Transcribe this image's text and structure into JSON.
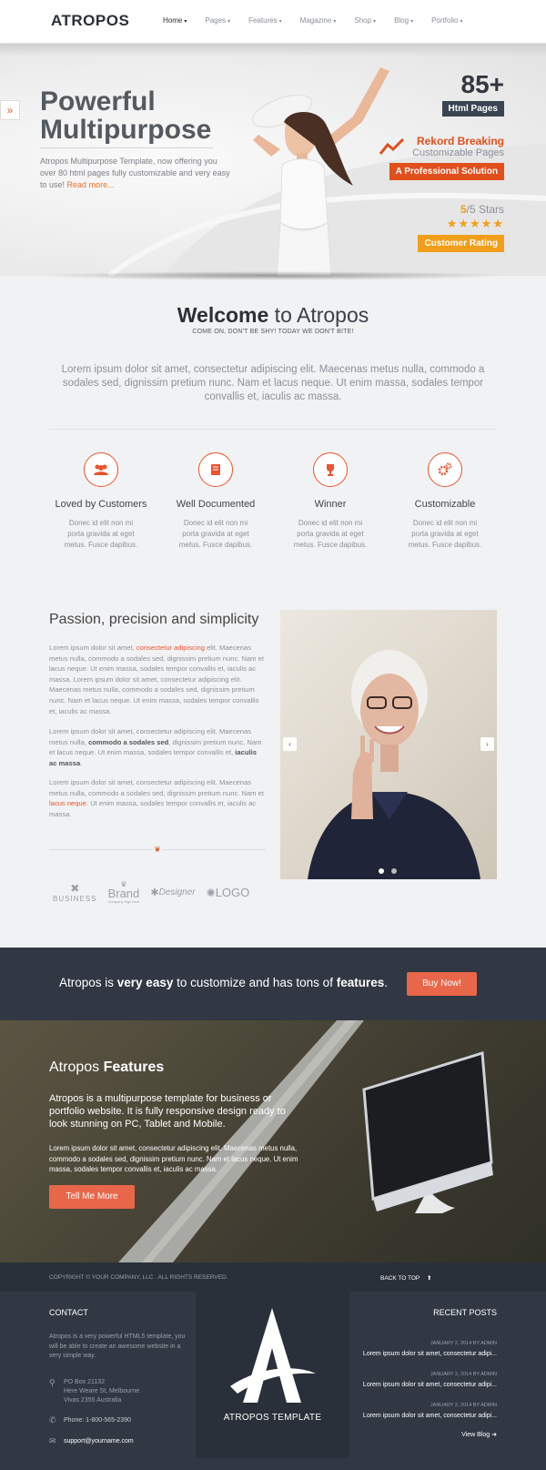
{
  "header": {
    "logo": "ATROPOS",
    "nav": [
      "Home",
      "Pages",
      "Features",
      "Magazine",
      "Shop",
      "Blog",
      "Portfolio"
    ]
  },
  "hero": {
    "title_line1": "Powerful",
    "title_line2": "Multipurpose",
    "text": "Atropos Multipurpose Template, now offering you over 80 html pages fully customizable and very easy to use!",
    "read_more": "Read more...",
    "stat_number": "85+",
    "stat_label": "Html Pages",
    "rekord_title": "Rekord Breaking",
    "rekord_sub": "Customizable Pages",
    "pro_badge": "A Professional Solution",
    "stars_value": "5",
    "stars_total": "/5 Stars",
    "stars_glyphs": "★★★★★",
    "rating_badge": "Customer Rating",
    "side_tab": "»"
  },
  "welcome": {
    "title_bold": "Welcome",
    "title_rest": " to Atropos",
    "subtitle": "COME ON, DON'T BE SHY! TODAY WE DON'T BITE!",
    "lead": "Lorem ipsum dolor sit amet, consectetur adipiscing elit. Maecenas metus nulla, commodo a sodales sed, dignissim pretium nunc. Nam et lacus neque. Ut enim massa, sodales tempor convallis et, iaculis ac massa."
  },
  "features": [
    {
      "icon": "users-icon",
      "title": "Loved by Customers",
      "text": "Donec id elit non mi porta gravida at eget metus. Fusce dapibus."
    },
    {
      "icon": "book-icon",
      "title": "Well Documented",
      "text": "Donec id elit non mi porta gravida at eget metus. Fusce dapibus."
    },
    {
      "icon": "trophy-icon",
      "title": "Winner",
      "text": "Donec id elit non mi porta gravida at eget metus. Fusce dapibus."
    },
    {
      "icon": "cogs-icon",
      "title": "Customizable",
      "text": "Donec id elit non mi porta gravida at eget metus. Fusce dapibus."
    }
  ],
  "passion": {
    "title": "Passion, precision and simplicity",
    "p1_a": "Lorem ipsum dolor sit amet, ",
    "p1_link": "consectetur adipiscing",
    "p1_b": " elit. Maecenas metus nulla, commodo a sodales sed, dignissim pretium nunc. Nam et lacus neque. Ut enim massa, sodales tempor convallis et, iaculis ac massa. Lorem ipsum dolor sit amet, consectetur adipiscing elit. Maecenas metus nulla, commodo a sodales sed, dignissim pretium nunc. Nam et lacus neque. Ut enim massa, sodales tempor convallis et, iaculis ac massa.",
    "p2_a": "Lorem ipsum dolor sit amet, consectetur adipiscing elit. Maecenas metus nulla, ",
    "p2_bold1": "commodo a sodales sed",
    "p2_b": ", dignissim pretium nunc. Nam et lacus neque. Ut enim massa, sodales tempor convallis et, ",
    "p2_bold2": "iaculis ac massa",
    "p2_c": ".",
    "p3_a": "Lorem ipsum dolor sit amet, consectetur adipiscing elit. Maecenas metus nulla, commodo a sodales sed, dignissim pretium nunc. Nam et ",
    "p3_link": "lacus neque",
    "p3_b": ". Ut enim massa, sodales tempor convallis et, iaculis ac massa.",
    "brands": [
      "BUSINESS",
      "Brand",
      "Company logo here",
      "Designer",
      "LOGO"
    ]
  },
  "slider": {
    "prev": "‹",
    "next": "›",
    "active_index": 0,
    "count": 2
  },
  "banner": {
    "text_a": "Atropos is ",
    "text_bold1": "very easy",
    "text_b": " to customize and has tons of ",
    "text_bold2": "features",
    "text_c": ".",
    "button": "Buy Now!"
  },
  "parallax": {
    "title_a": "Atropos ",
    "title_bold": "Features",
    "lead": "Atropos is a multipurpose template for business or portfolio website. It is fully responsive design ready to look stunning on PC, Tablet and Mobile.",
    "text": "Lorem ipsum dolor sit amet, consectetur adipiscing elit. Maecenas metus nulla, commodo a sodales sed, dignissim pretium nunc. Nam et lacus neque. Ut enim massa, sodales tempor convallis et, iaculis ac massa.",
    "button": "Tell Me More"
  },
  "copybar": {
    "copyright": "COPYRIGHT © YOUR COMPANY, LLC . ALL RIGHTS RESERVED.",
    "back_to_top": "BACK TO TOP"
  },
  "footer": {
    "contact_heading": "CONTACT",
    "about": "Atropos is a very powerful HTML5 template, you will be able to create an awesome website in a very simple way.",
    "address": [
      "PO Box 21132",
      "Here Weare St, Melbourne",
      "Vivas 2355 Australia"
    ],
    "phone": "Phone: 1-800-565-2390",
    "email": "support@yourname.com",
    "template_label": "ATROPOS TEMPLATE",
    "recent_heading": "RECENT POSTS",
    "posts": [
      {
        "date": "JANUARY 2, 2014 BY ADMIN",
        "title": "Lorem ipsum dolor sit amet, consectetur adipi..."
      },
      {
        "date": "JANUARY 2, 2014 BY ADMIN",
        "title": "Lorem ipsum dolor sit amet, consectetur adipi..."
      },
      {
        "date": "JANUARY 2, 2014 BY ADMIN",
        "title": "Lorem ipsum dolor sit amet, consectetur adipi..."
      }
    ],
    "view_blog": "View Blog"
  },
  "colors": {
    "accent": "#e8542f",
    "dark": "#313844",
    "orange": "#f29e1a",
    "navy": "#3a4452"
  }
}
